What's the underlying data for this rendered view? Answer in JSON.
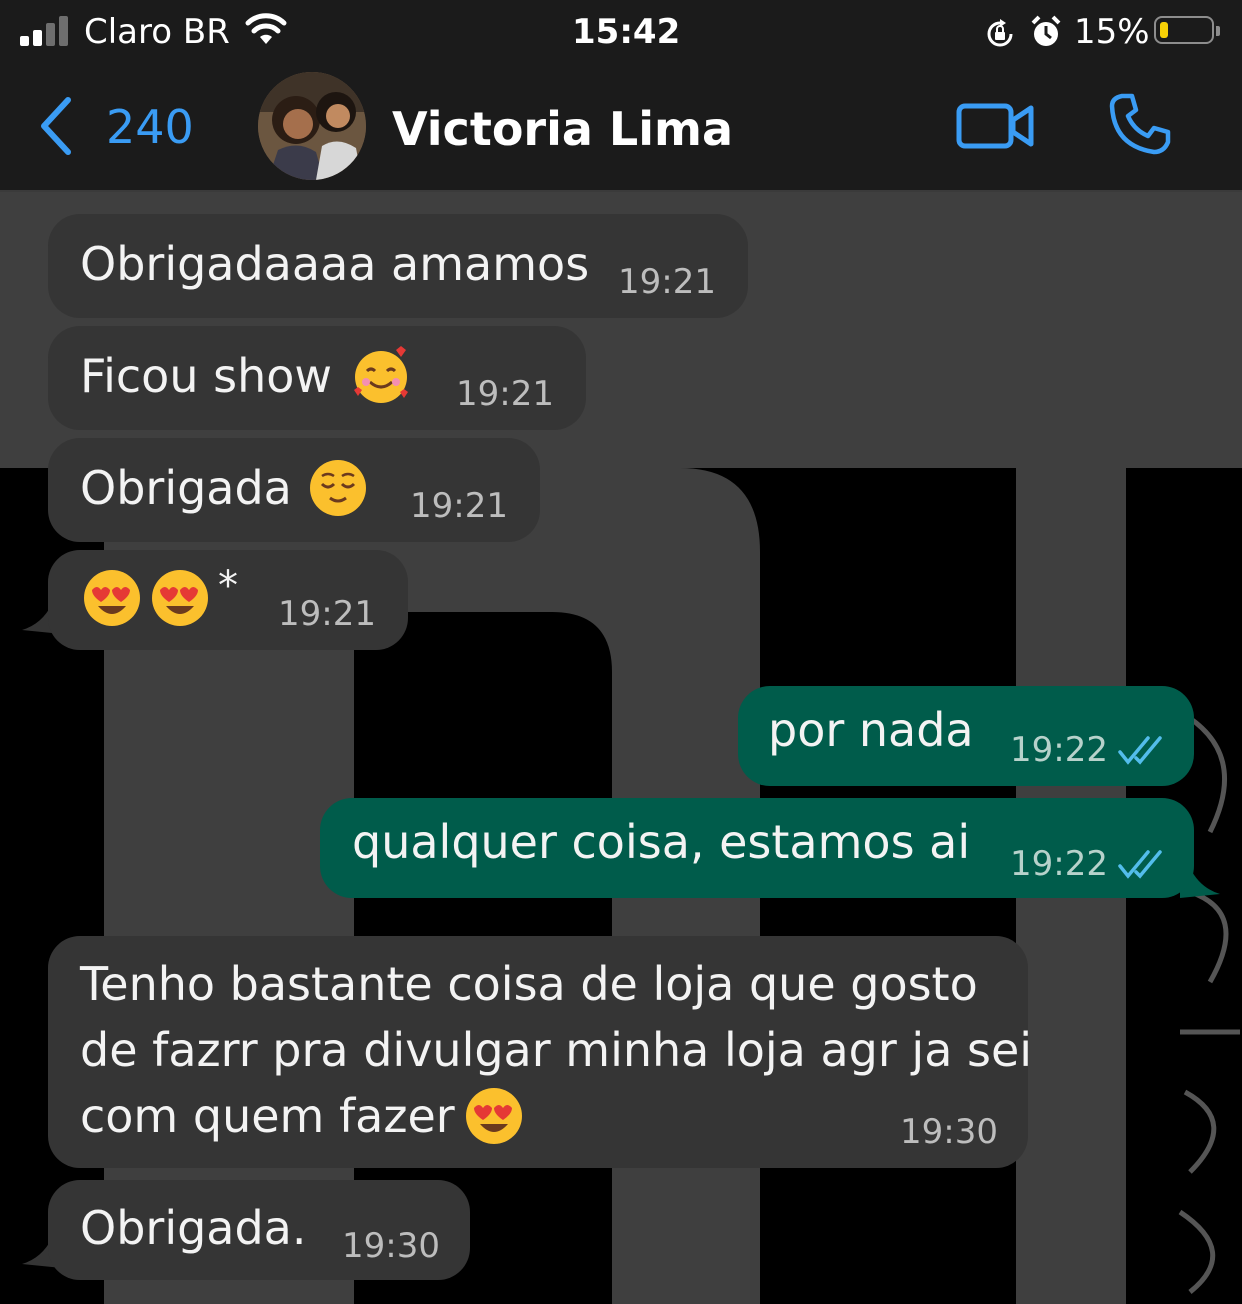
{
  "status": {
    "carrier": "Claro BR",
    "time": "15:42",
    "battery_percent": "15%",
    "battery_level": 0.15,
    "battery_color": "#f7d106"
  },
  "header": {
    "back_count": "240",
    "contact_name": "Victoria Lima",
    "accent_color": "#3a9cf4"
  },
  "messages": [
    {
      "direction": "in",
      "text": "Obrigadaaaa amamos",
      "time": "19:21"
    },
    {
      "direction": "in",
      "text": "Ficou show",
      "emoji": "smiling-face-with-hearts",
      "time": "19:21"
    },
    {
      "direction": "in",
      "text": "Obrigada",
      "emoji": "relieved-face",
      "time": "19:21"
    },
    {
      "direction": "in",
      "text": "*",
      "emoji": "heart-eyes x2",
      "time": "19:21"
    },
    {
      "direction": "out",
      "text": "por nada",
      "time": "19:22",
      "read": true
    },
    {
      "direction": "out",
      "text": "qualquer coisa, estamos ai",
      "time": "19:22",
      "read": true
    },
    {
      "direction": "in",
      "lines": [
        "Tenho bastante coisa de loja que gosto",
        "de fazrr pra divulgar minha loja agr ja sei",
        "com quem fazer"
      ],
      "emoji": "heart-eyes",
      "time": "19:30"
    },
    {
      "direction": "in",
      "text": "Obrigada.",
      "time": "19:30"
    }
  ]
}
